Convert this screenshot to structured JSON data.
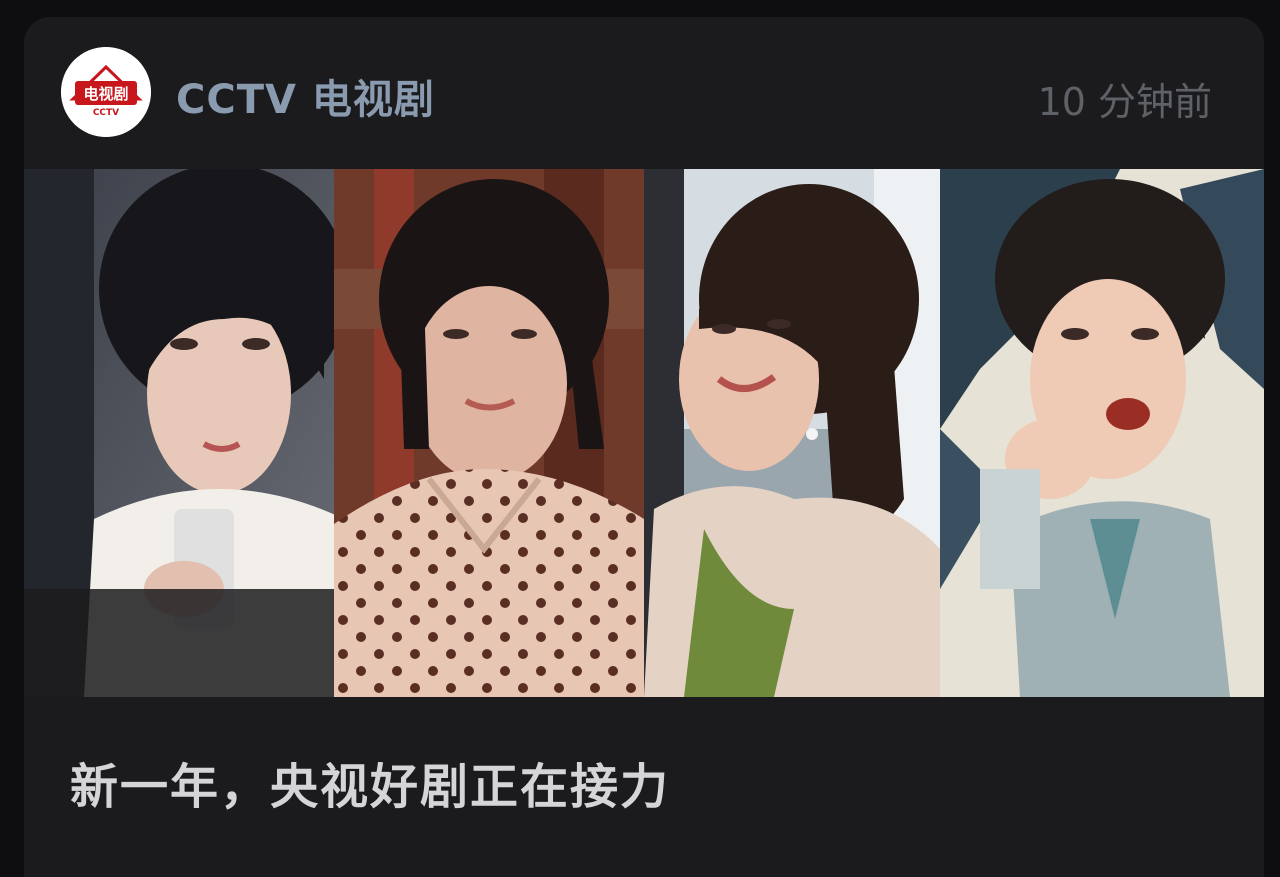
{
  "account": {
    "name": "CCTV 电视剧",
    "avatar_logo_text": "电视剧",
    "avatar_logo_subtext": "CCTV",
    "avatar_icon": "cctv-drama-logo-icon",
    "timestamp": "10 分钟前"
  },
  "banner": {
    "stills": [
      {
        "icon": "drama-still-woman-with-glass"
      },
      {
        "icon": "drama-still-woman-polka-dot"
      },
      {
        "icon": "drama-still-woman-smiling"
      },
      {
        "icon": "drama-still-man-period-costume"
      }
    ]
  },
  "post": {
    "headline": "新一年，央视好剧正在接力"
  },
  "colors": {
    "card_bg": "#1b1b1d",
    "account_name": "#8a9bb0",
    "timestamp": "#5e6167",
    "headline": "#d5d5d7",
    "logo_red": "#c8161d"
  }
}
